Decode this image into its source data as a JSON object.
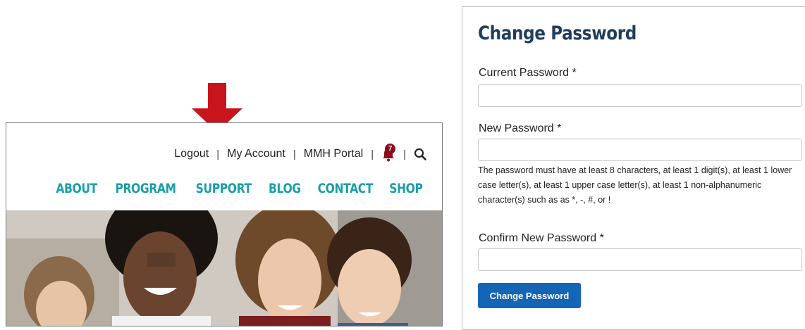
{
  "site": {
    "utility_nav": {
      "logout": "Logout",
      "my_account": "My Account",
      "portal": "MMH Portal",
      "separator": "|",
      "notification_count": "7",
      "bell_icon": "bell-icon",
      "search_icon": "search-icon"
    },
    "main_nav": [
      "ABOUT",
      "PROGRAM",
      "SUPPORT",
      "BLOG",
      "CONTACT",
      "SHOP"
    ]
  },
  "form": {
    "title": "Change Password",
    "current_password_label": "Current Password *",
    "new_password_label": "New Password *",
    "password_help": "The password must have at least 8 characters, at least 1 digit(s), at least 1 lower case letter(s), at least 1 upper case letter(s), at least 1 non-alphanumeric character(s) such as as *, -, #, or !",
    "confirm_password_label": "Confirm New Password *",
    "submit_label": "Change Password"
  },
  "colors": {
    "nav_teal": "#1a9fa8",
    "title_navy": "#1f3d5e",
    "button_blue": "#1565b7",
    "arrow_red": "#c8141c",
    "badge_red": "#8b0d1c"
  }
}
